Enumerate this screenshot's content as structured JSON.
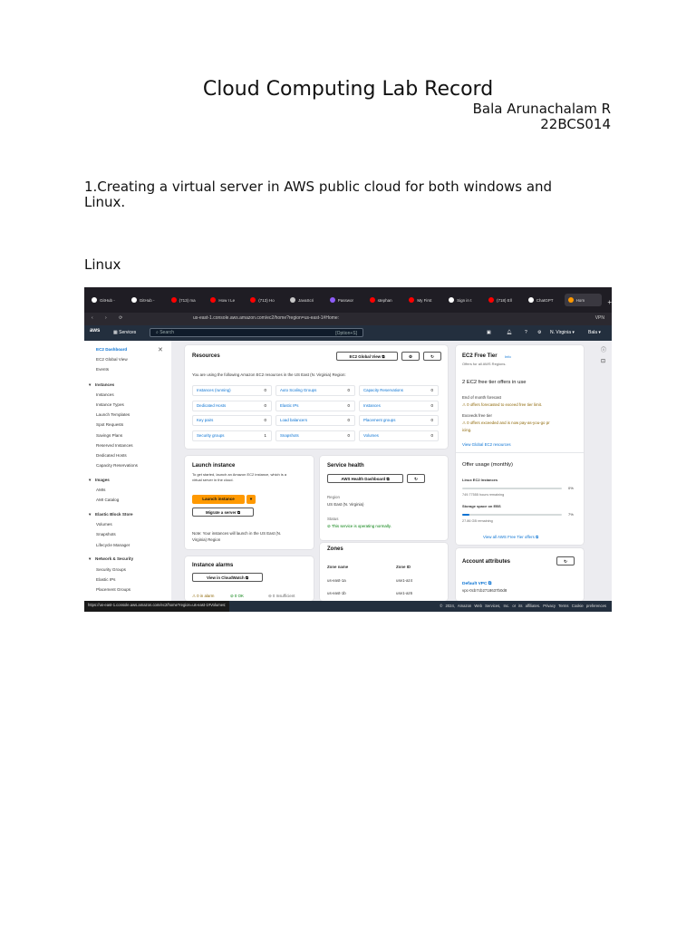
{
  "document": {
    "title": "Cloud Computing Lab Record",
    "author": "Bala Arunachalam R",
    "roll": "22BCS014",
    "question": "1.Creating a virtual server in AWS public cloud for both windows and Linux.",
    "section": "Linux"
  },
  "screenshot": {
    "tabs": [
      {
        "label": "GitHub -",
        "color": "#ffffff"
      },
      {
        "label": "GitHub -",
        "color": "#ffffff"
      },
      {
        "label": "(713) ma",
        "color": "#ff0000"
      },
      {
        "label": "How I Le",
        "color": "#ff0000"
      },
      {
        "label": "(713) Ho",
        "color": "#ff0000"
      },
      {
        "label": "JavaScri",
        "color": "#c8c8c8"
      },
      {
        "label": "Passwor",
        "color": "#8e5cf7"
      },
      {
        "label": "stephan",
        "color": "#ff0000"
      },
      {
        "label": "My First",
        "color": "#ff0000"
      },
      {
        "label": "Sign in t",
        "color": "#ffffff"
      },
      {
        "label": "(718) Ell",
        "color": "#ff0000"
      },
      {
        "label": "ChatGPT",
        "color": "#ffffff"
      },
      {
        "label": "Hom",
        "color": "#ff9900"
      }
    ],
    "new_tab": "+",
    "nav_icons": "‹ › ⟳",
    "url": "us-east-1.console.aws.amazon.com/ec2/home?region=us-east-1#Home:",
    "browser_right": "VPN",
    "aws": {
      "logo": "aws",
      "services": "Services",
      "search_placeholder": "Search",
      "search_shortcut": "[Option+S]",
      "region": "N. Virginia ▾",
      "user": "Bala ▾"
    },
    "sidebar": {
      "top": [
        "EC2 Dashboard",
        "EC2 Global View",
        "Events"
      ],
      "sections": [
        {
          "title": "Instances",
          "items": [
            "Instances",
            "Instance Types",
            "Launch Templates",
            "Spot Requests",
            "Savings Plans",
            "Reserved Instances",
            "Dedicated Hosts",
            "Capacity Reservations"
          ]
        },
        {
          "title": "Images",
          "items": [
            "AMIs",
            "AMI Catalog"
          ]
        },
        {
          "title": "Elastic Block Store",
          "items": [
            "Volumes",
            "Snapshots",
            "Lifecycle Manager"
          ]
        },
        {
          "title": "Network & Security",
          "items": [
            "Security Groups",
            "Elastic IPs",
            "Placement Groups"
          ]
        }
      ]
    },
    "resources": {
      "title": "Resources",
      "global_view_button": "EC2 Global View",
      "intro": "You are using the following Amazon EC2 resources in the US East (N. Virginia) Region:",
      "cells": [
        {
          "name": "Instances (running)",
          "value": "0"
        },
        {
          "name": "Auto Scaling Groups",
          "value": "0"
        },
        {
          "name": "Capacity Reservations",
          "value": "0"
        },
        {
          "name": "Dedicated Hosts",
          "value": "0"
        },
        {
          "name": "Elastic IPs",
          "value": "0"
        },
        {
          "name": "Instances",
          "value": "0"
        },
        {
          "name": "Key pairs",
          "value": "0"
        },
        {
          "name": "Load balancers",
          "value": "0"
        },
        {
          "name": "Placement groups",
          "value": "0"
        },
        {
          "name": "Security groups",
          "value": "1"
        },
        {
          "name": "Snapshots",
          "value": "0"
        },
        {
          "name": "Volumes",
          "value": "0"
        }
      ]
    },
    "launch": {
      "title": "Launch instance",
      "desc1": "To get started, launch an Amazon EC2 instance, which is a",
      "desc2": "virtual server in the cloud.",
      "launch_button": "Launch instance",
      "migrate_button": "Migrate a server",
      "note1": "Note: Your instances will launch in the US East (N.",
      "note2": "Virginia) Region"
    },
    "health": {
      "title": "Service health",
      "dashboard_button": "AWS Health Dashboard",
      "region_label": "Region",
      "region_value": "US East (N. Virginia)",
      "status_label": "Status",
      "status_value": "This service is operating normally."
    },
    "zones": {
      "title": "Zones",
      "col_name": "Zone name",
      "col_id": "Zone ID",
      "rows": [
        {
          "name": "us-east-1a",
          "id": "use1-az4"
        },
        {
          "name": "us-east-1b",
          "id": "use1-az6"
        }
      ]
    },
    "alarms": {
      "title": "Instance alarms",
      "cloudwatch_button": "View in CloudWatch",
      "in_alarm": "0 in alarm",
      "ok": "0 OK",
      "insufficient": "0 Insufficient"
    },
    "free_tier": {
      "title": "EC2 Free Tier",
      "info": "Info",
      "subtitle": "Offers for all AWS Regions.",
      "offers_heading": "2 EC2 free tier offers in use",
      "forecast_label": "End of month forecast",
      "forecast_value": "0 offers forecasted to exceed free tier limit.",
      "exceeds_label": "Exceeds free tier",
      "exceeds_value1": "0 offers exceeded and is now pay-as-you-go pr",
      "exceeds_value2": "icing.",
      "view_link": "View Global EC2 resources"
    },
    "usage": {
      "title": "Offer usage (monthly)",
      "linux_label": "Linux EC2 Instances",
      "linux_pct": "0%",
      "linux_fill": 0.0,
      "linux_remaining": "749.77555 hours remaining",
      "ebs_label": "Storage space on EBS",
      "ebs_pct": "7%",
      "ebs_fill": 0.07,
      "ebs_remaining": "27.86 GB remaining",
      "view_all": "View all AWS Free Tier offers"
    },
    "account": {
      "title": "Account attributes",
      "vpc_label": "Default VPC",
      "vpc_value": "vpc-0cb7cb2718637b0d8"
    },
    "footer": {
      "link_preview": "https://us-east-1.console.aws.amazon.com/ec2/home?region=us-east-1#Volumes:",
      "copyright": "© 2024, Amazon Web Services, Inc. or its affiliates.",
      "privacy": "Privacy",
      "terms": "Terms",
      "cookies": "Cookie preferences"
    }
  }
}
